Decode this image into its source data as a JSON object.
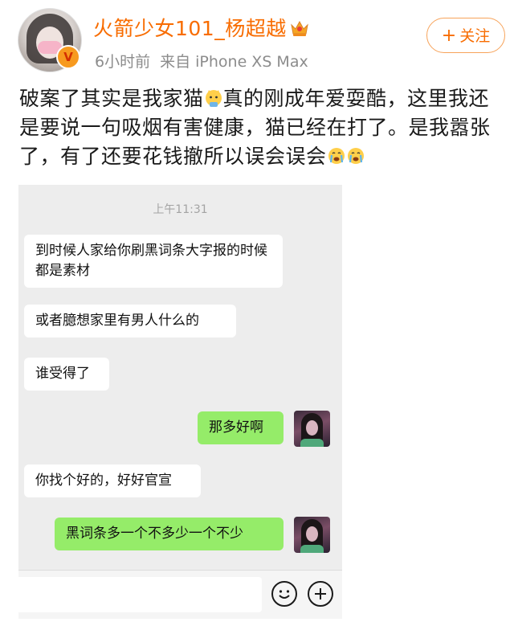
{
  "post": {
    "username": "火箭少女101_杨超越",
    "time": "6小时前",
    "source": "来自 iPhone XS Max",
    "follow_label": "关注",
    "text_part1": "破案了其实是我家猫",
    "text_part2": "真的刚成年爱耍酷，这里我还是要说一句吸烟有害健康，猫已经在打了。是我嚣张了，有了还要花钱撤所以误会误会",
    "accent_color": "#f86c00",
    "icons": [
      "crown-icon",
      "verified-badge-icon",
      "cat-emoji-icon",
      "crying-emoji-icon"
    ]
  },
  "chat": {
    "time": "上午11:31",
    "messages": [
      {
        "side": "left",
        "text": "到时候人家给你刷黑词条大字报的时候都是素材"
      },
      {
        "side": "left",
        "text": "或者臆想家里有男人什么的"
      },
      {
        "side": "left",
        "text": "谁受得了"
      },
      {
        "side": "right",
        "text": "那多好啊"
      },
      {
        "side": "left",
        "text": "你找个好的，好好官宣"
      },
      {
        "side": "right",
        "text": "黑词条多一个不多少一个不少"
      }
    ],
    "bubble_color_self": "#95ec69",
    "bubble_color_other": "#ffffff"
  }
}
